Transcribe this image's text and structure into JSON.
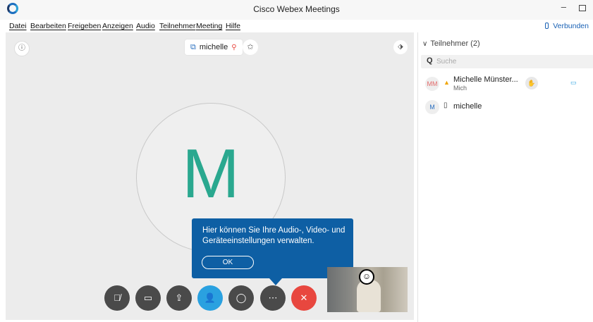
{
  "window": {
    "title": "Cisco Webex Meetings"
  },
  "menu": [
    "Datei",
    "Bearbeiten",
    "Freigeben",
    "Anzeigen",
    "Audio",
    "Teilnehmer",
    "Meeting",
    "Hilfe"
  ],
  "status": "Verbunden",
  "stage": {
    "presenter_name": "michelle",
    "avatar_letter": "M"
  },
  "tooltip": {
    "text": "Hier können Sie Ihre Audio-, Video- und Geräteeinstellungen verwalten.",
    "ok_label": "OK"
  },
  "controls": [
    {
      "name": "mute-button",
      "icon": "mic-muted-icon"
    },
    {
      "name": "video-button",
      "icon": "video-off-icon"
    },
    {
      "name": "share-button",
      "icon": "share-icon"
    },
    {
      "name": "participants-button",
      "icon": "participants-icon"
    },
    {
      "name": "chat-button",
      "icon": "chat-icon"
    },
    {
      "name": "more-button",
      "icon": "more-icon"
    },
    {
      "name": "end-meeting-button",
      "icon": "close-icon"
    }
  ],
  "panel": {
    "header": "Teilnehmer (2)",
    "search_placeholder": "Suche",
    "participants": [
      {
        "initials": "MM",
        "name": "Michelle Münster...",
        "sub": "Mich"
      },
      {
        "initials": "M",
        "name": "michelle",
        "sub": ""
      }
    ]
  },
  "colors": {
    "accent": "#0e5fa4",
    "avatar": "#2aa88f",
    "end": "#e8473f",
    "participants_btn": "#2aa1e0"
  }
}
